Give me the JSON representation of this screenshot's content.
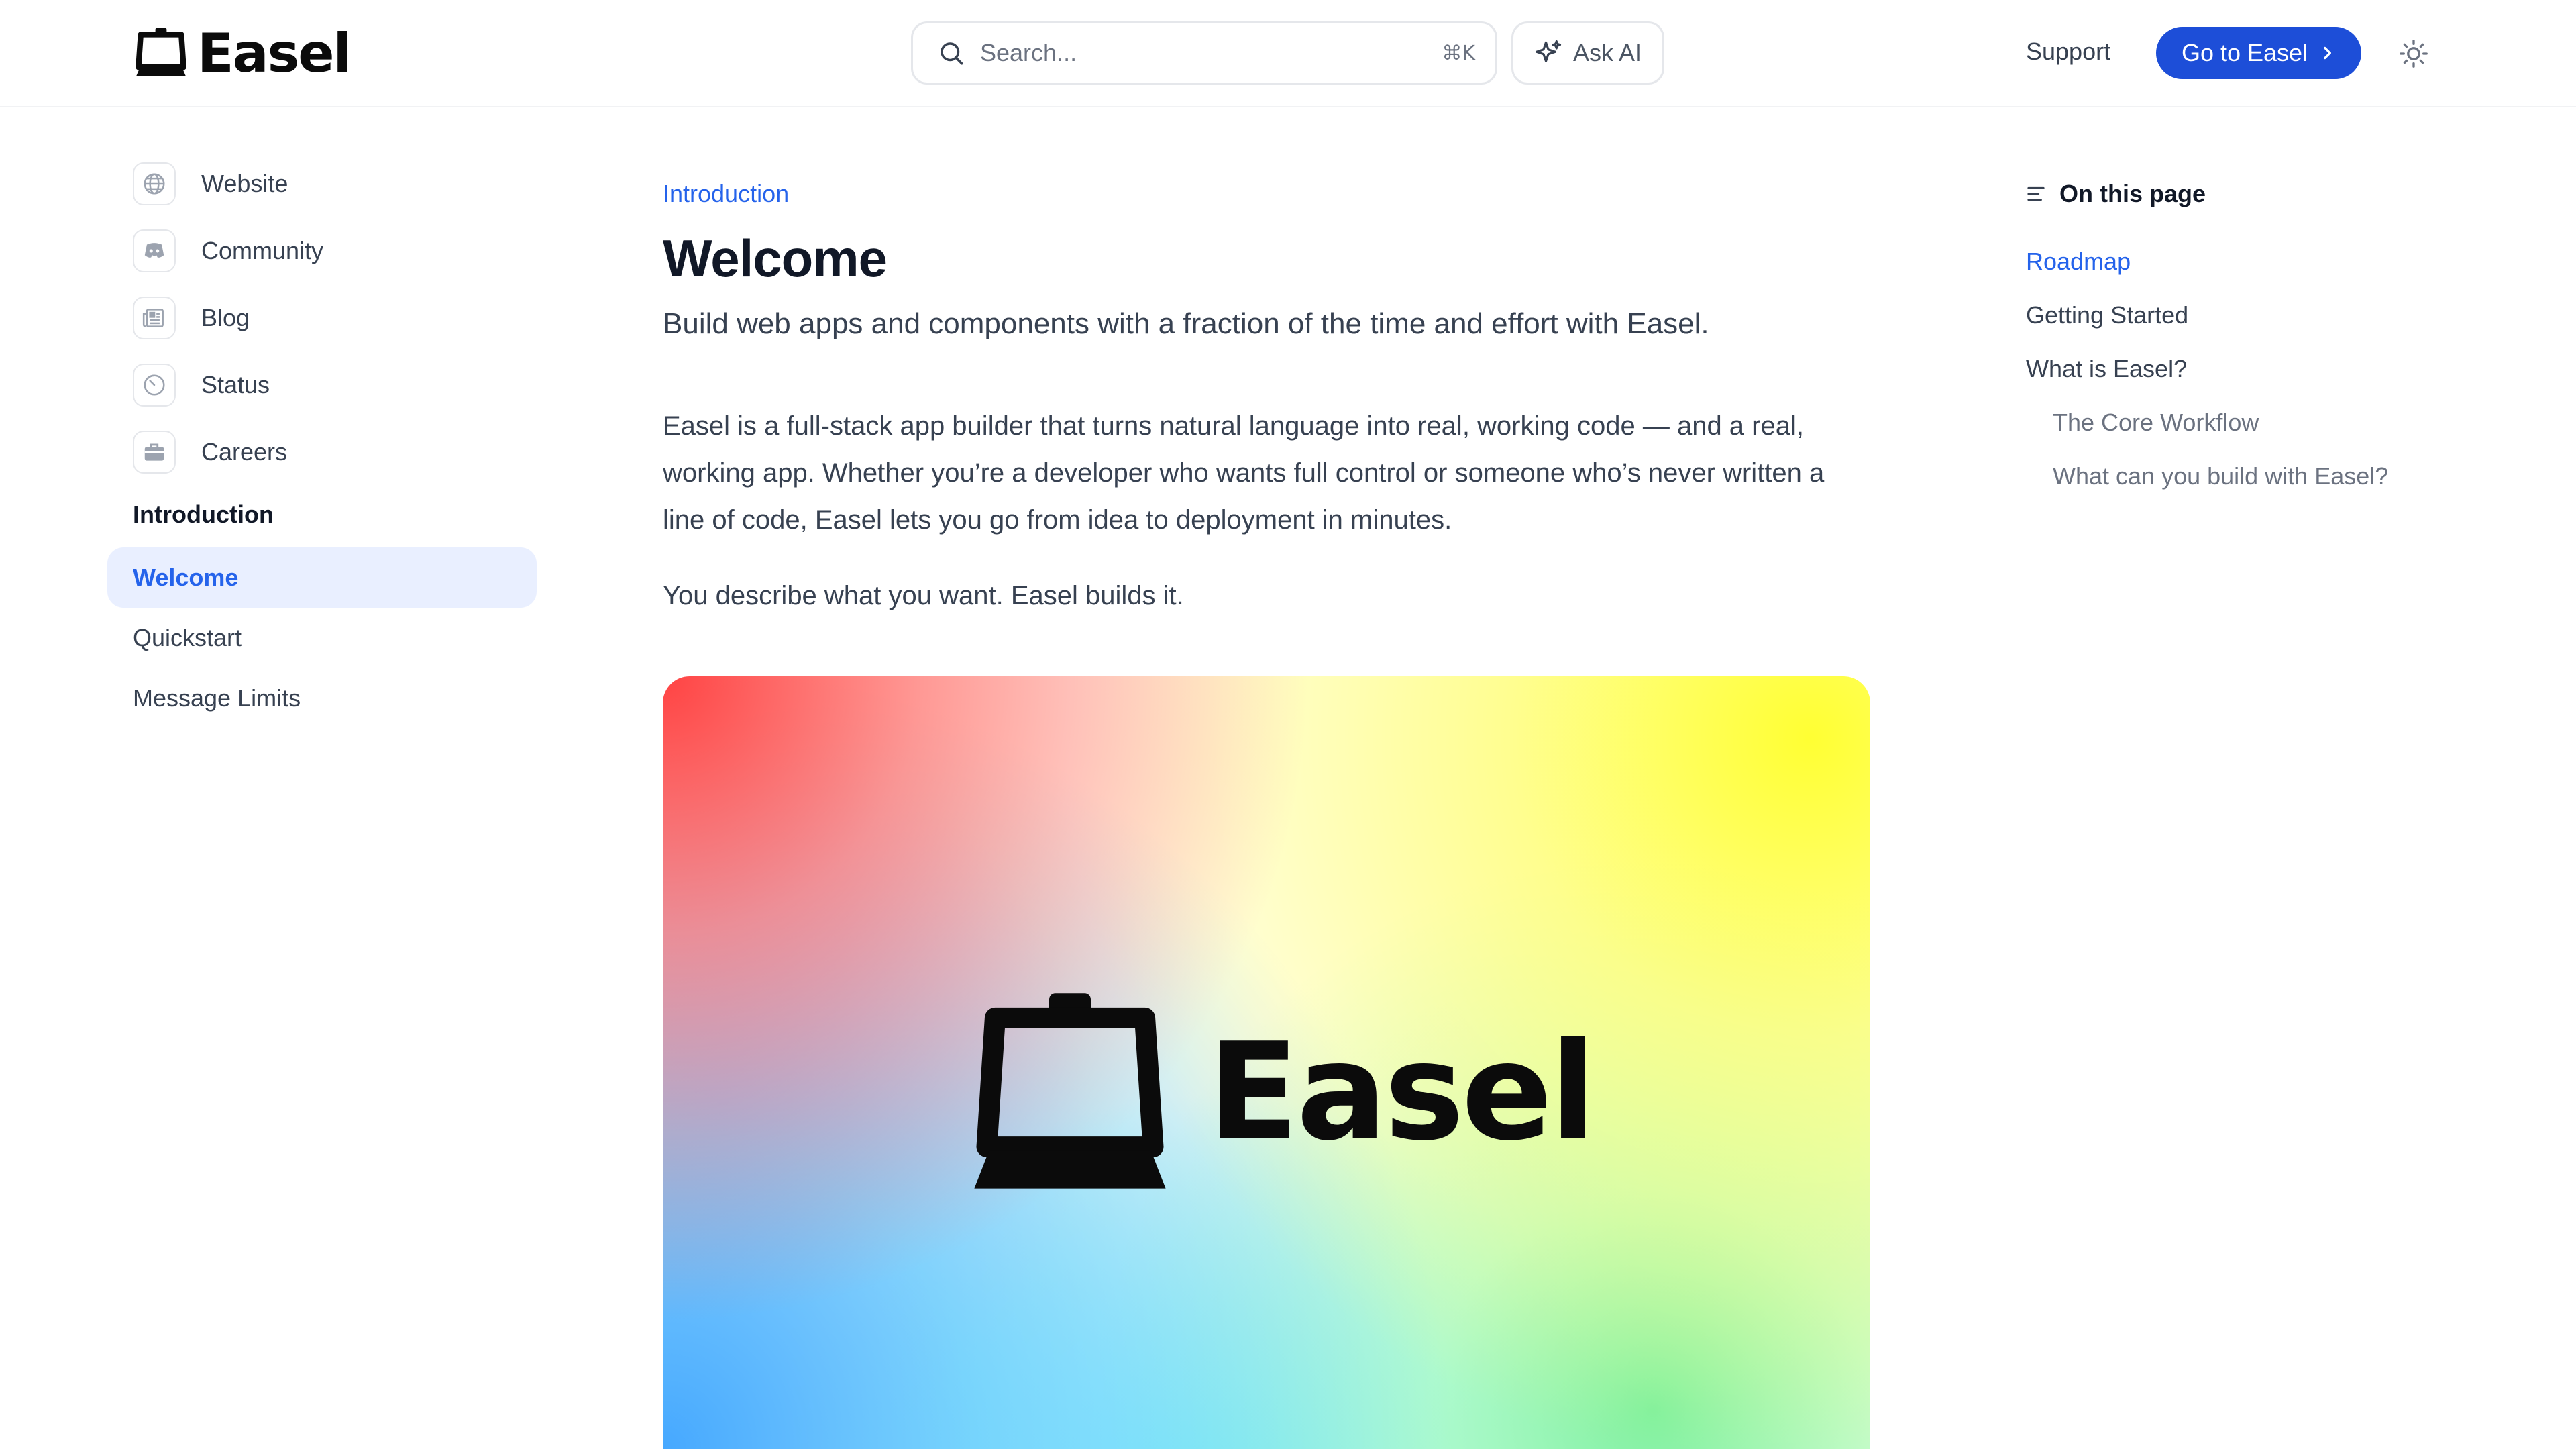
{
  "app": {
    "logo_text": "Easel"
  },
  "header": {
    "search_placeholder": "Search...",
    "search_shortcut": "⌘K",
    "ask_ai_label": "Ask AI",
    "support_label": "Support",
    "cta_label": "Go to Easel",
    "icons": [
      "search-icon",
      "sparkle-icon",
      "chevron-right-icon",
      "sun-icon"
    ]
  },
  "sidebar": {
    "links": [
      {
        "label": "Website",
        "icon": "globe-icon"
      },
      {
        "label": "Community",
        "icon": "discord-icon"
      },
      {
        "label": "Blog",
        "icon": "newspaper-icon"
      },
      {
        "label": "Status",
        "icon": "status-icon"
      },
      {
        "label": "Careers",
        "icon": "briefcase-icon"
      }
    ],
    "section_title": "Introduction",
    "nav": [
      {
        "label": "Welcome",
        "active": true
      },
      {
        "label": "Quickstart",
        "active": false
      },
      {
        "label": "Message Limits",
        "active": false
      }
    ]
  },
  "main": {
    "breadcrumb": "Introduction",
    "title": "Welcome",
    "subtitle": "Build web apps and components with a fraction of the time and effort with Easel.",
    "paragraph1": "Easel is a full-stack app builder that turns natural language into real, working code — and a real, working app. Whether you’re a developer who wants full control or someone who’s never written a line of code, Easel lets you go from idea to deployment in minutes.",
    "paragraph2": "You describe what you want. Easel builds it.",
    "hero_logo_text": "Easel"
  },
  "toc": {
    "heading": "On this page",
    "items": [
      {
        "label": "Roadmap",
        "active": true,
        "level": 1
      },
      {
        "label": "Getting Started",
        "active": false,
        "level": 1
      },
      {
        "label": "What is Easel?",
        "active": false,
        "level": 1
      },
      {
        "label": "The Core Workflow",
        "active": false,
        "level": 2
      },
      {
        "label": "What can you build with Easel?",
        "active": false,
        "level": 2
      }
    ]
  },
  "colors": {
    "accent": "#2563eb",
    "cta_bg": "#1d4ed8",
    "active_nav_bg": "#e9efff",
    "text": "#374151"
  }
}
